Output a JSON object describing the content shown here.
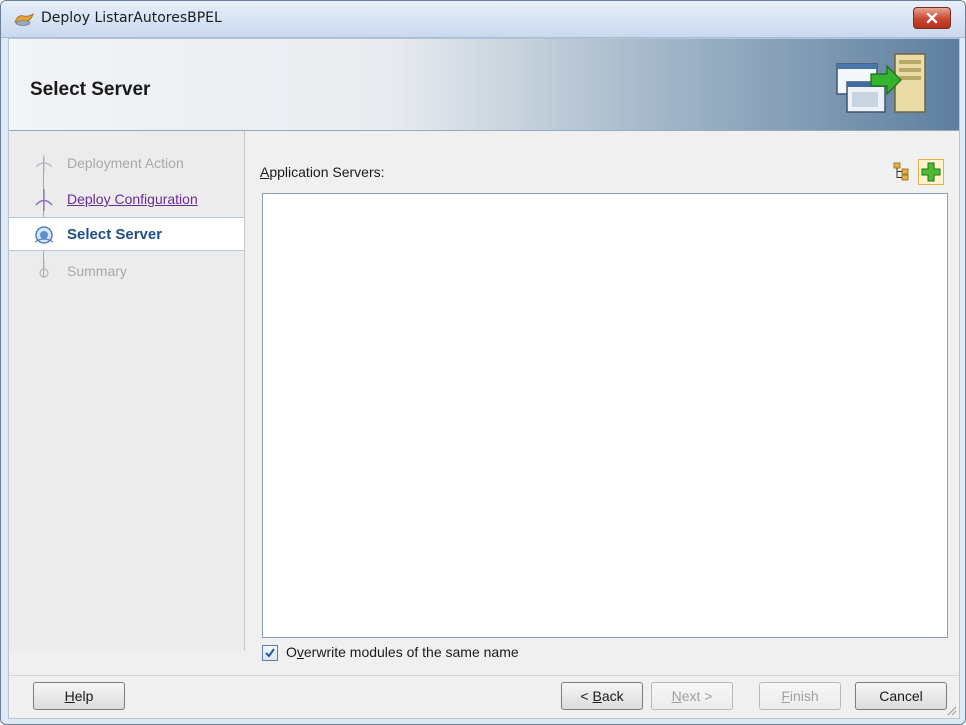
{
  "window": {
    "title": "Deploy ListarAutoresBPEL",
    "close_icon": "close-icon"
  },
  "header": {
    "title": "Select Server",
    "art_icon": "deploy-to-server-icon"
  },
  "nav": {
    "items": [
      {
        "label": "Deployment Action",
        "state": "disabled",
        "icon": "step-icon"
      },
      {
        "label": "Deploy Configuration",
        "state": "link",
        "icon": "step-icon"
      },
      {
        "label": "Select Server",
        "state": "current",
        "icon": "current-step-icon"
      },
      {
        "label": "Summary",
        "state": "disabled",
        "icon": "step-end-icon"
      }
    ]
  },
  "main": {
    "servers_label_mnemonic": "A",
    "servers_label_rest": "pplication Servers:",
    "toolbar": {
      "tree_icon": "tree-view-icon",
      "add_icon": "add-server-icon"
    },
    "servers": [],
    "overwrite": {
      "checked": true,
      "label_prefix": "O",
      "label_mnemonic": "v",
      "label_rest": "erwrite modules of the same name"
    }
  },
  "footer": {
    "help": {
      "mnemonic": "H",
      "rest": "elp"
    },
    "back": {
      "prefix": "< ",
      "mnemonic": "B",
      "rest": "ack"
    },
    "next": {
      "mnemonic": "N",
      "rest": "ext >"
    },
    "finish": {
      "mnemonic": "F",
      "rest": "inish"
    },
    "cancel": "Cancel"
  },
  "colors": {
    "current_step": "#1f4e8c",
    "visited_link": "#6a2c91",
    "disabled_text": "#a8a8a8"
  }
}
